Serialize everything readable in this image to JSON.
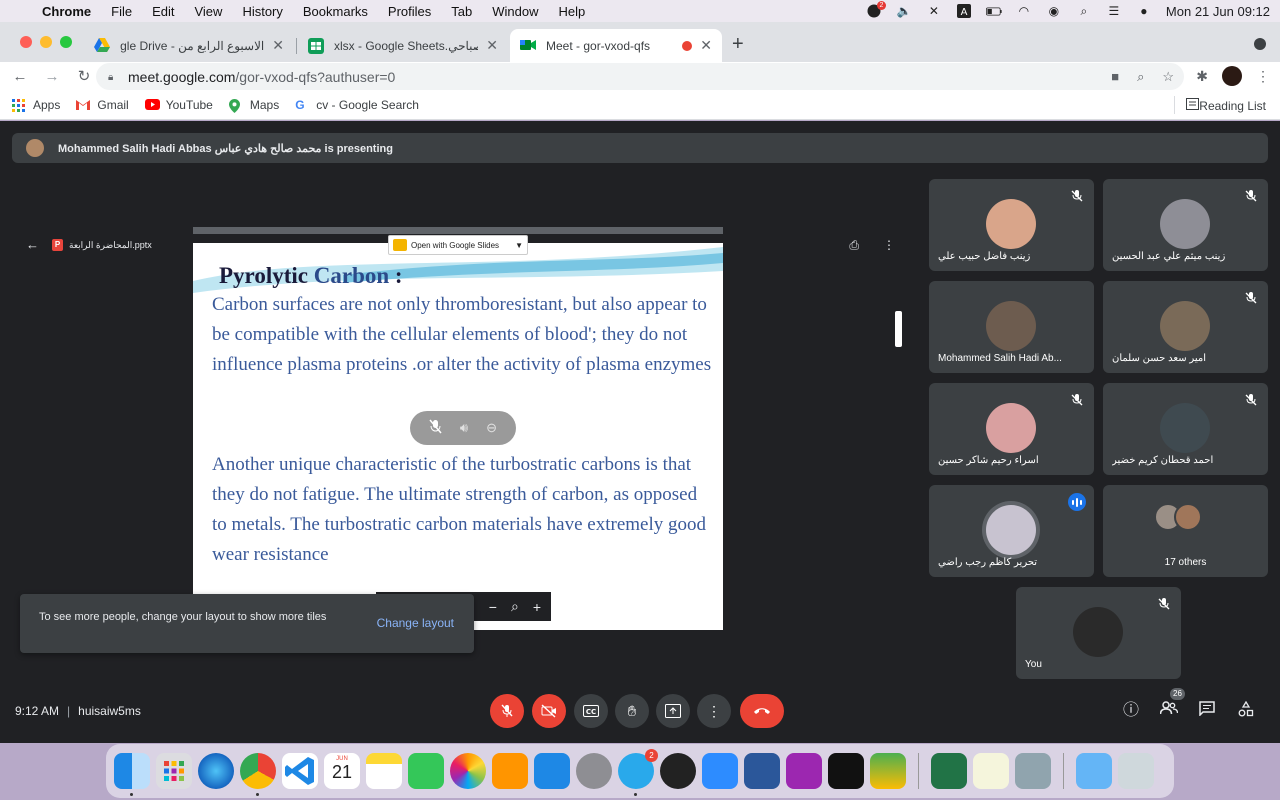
{
  "menubar": {
    "app_name": "Chrome",
    "items": [
      "File",
      "Edit",
      "View",
      "History",
      "Bookmarks",
      "Profiles",
      "Tab",
      "Window",
      "Help"
    ],
    "clock": "Mon 21 Jun  09:12",
    "notification_badge": "2"
  },
  "tabs": [
    {
      "title": "الاسبوع الرابع من - Google Drive",
      "favicon": "google-drive-icon"
    },
    {
      "title": "xlsx - Google Sheets.الصباحي",
      "favicon": "google-sheets-icon"
    },
    {
      "title": "Meet - gor-vxod-qfs",
      "favicon": "google-meet-icon"
    }
  ],
  "toolbar": {
    "url_host": "meet.google.com",
    "url_path": "/gor-vxod-qfs?authuser=0"
  },
  "bookmarks": {
    "items": [
      "Apps",
      "Gmail",
      "YouTube",
      "Maps",
      "cv - Google Search"
    ],
    "reading_list": "Reading List"
  },
  "meet": {
    "presenting_banner": "Mohammed Salih Hadi Abbas محمد صالح هادي عباس is presenting",
    "file_name": "المحاضرة الرابعة.pptx",
    "open_with": "Open with Google Slides",
    "slide": {
      "title_part1": "Pyrolytic",
      "title_part2": "Carbon",
      "title_part3": " :",
      "para1": "Carbon surfaces are not only thromboresistant, but also appear to be compatible with the cellular elements of blood'; they do not influence plasma proteins .or alter the activity of plasma enzymes",
      "para2": "Another unique characteristic of the turbostratic carbons is that they do not fatigue. The ultimate strength of  carbon, as opposed to metals. The turbostratic carbon materials have extremely good wear resistance"
    },
    "toast": {
      "message": "To see more people, change your layout to show more tiles",
      "action": "Change layout"
    },
    "participants": [
      {
        "name": "زينب فاضل حبيب علي",
        "muted": true,
        "color": "#d9a58a"
      },
      {
        "name": "زينب ميثم علي عبد الحسين",
        "muted": true,
        "color": "#8e8e96"
      },
      {
        "name": "Mohammed Salih Hadi Ab...",
        "muted": false,
        "color": "#6d5c4f"
      },
      {
        "name": "امير سعد حسن سلمان",
        "muted": true,
        "color": "#7a6a58"
      },
      {
        "name": "اسراء رحيم شاكر حسين",
        "muted": true,
        "color": "#d9a0a0"
      },
      {
        "name": "احمد قحطان كريم خضير",
        "muted": true,
        "color": "#3f4a50"
      },
      {
        "name": "تحرير كاظم رجب راضي",
        "muted": false,
        "color": "#c8c3d0"
      },
      {
        "name": "17 others",
        "muted": false,
        "color": "#888"
      },
      {
        "name": "You",
        "muted": true,
        "color": "#2a2a2a"
      }
    ],
    "footer": {
      "time": "9:12 AM",
      "meeting_code": "huisaiw5ms",
      "people_count": "26"
    }
  },
  "dock": {
    "calendar_month": "JUN",
    "calendar_day": "21",
    "telegram_badge": "2"
  }
}
